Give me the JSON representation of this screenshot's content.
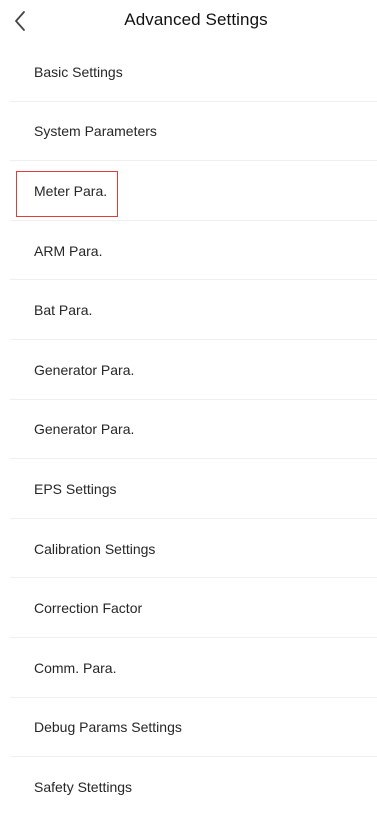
{
  "header": {
    "title": "Advanced Settings",
    "back_icon": "chevron-left-icon"
  },
  "menu": {
    "items": [
      {
        "label": "Basic Settings"
      },
      {
        "label": "System Parameters"
      },
      {
        "label": "Meter Para.",
        "highlighted": true
      },
      {
        "label": "ARM Para."
      },
      {
        "label": "Bat Para."
      },
      {
        "label": "Generator Para."
      },
      {
        "label": "Generator Para."
      },
      {
        "label": "EPS Settings"
      },
      {
        "label": "Calibration Settings"
      },
      {
        "label": "Correction Factor"
      },
      {
        "label": "Comm. Para."
      },
      {
        "label": "Debug Params Settings"
      },
      {
        "label": "Safety Stettings"
      }
    ]
  },
  "colors": {
    "highlight_border": "#e23b3b",
    "divider": "#efefef"
  }
}
